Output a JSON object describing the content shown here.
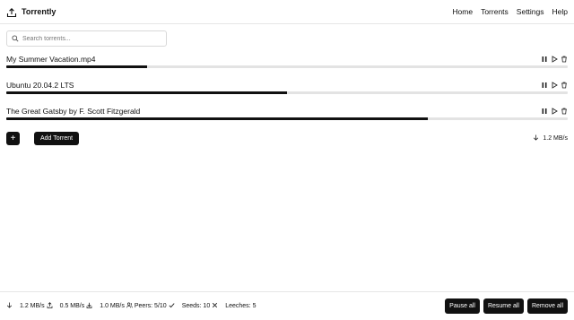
{
  "app": {
    "title": "Torrently"
  },
  "nav": {
    "items": [
      "Home",
      "Torrents",
      "Settings",
      "Help"
    ]
  },
  "search": {
    "placeholder": "Search torrents...",
    "value": ""
  },
  "torrents": [
    {
      "name": "My Summer Vacation.mp4",
      "progress": 0.25
    },
    {
      "name": "Ubuntu 20.04.2 LTS",
      "progress": 0.5
    },
    {
      "name": "The Great Gatsby by F. Scott Fitzgerald",
      "progress": 0.75
    }
  ],
  "toolbar": {
    "plus_label": "+",
    "add_label": "Add Torrent",
    "download_speed": "1.2 MB/s"
  },
  "footer": {
    "download": "1.2 MB/s",
    "upload": "0.5 MB/s",
    "download2": "1.0 MB/s",
    "peers": "Peers: 5/10",
    "seeds": "Seeds: 10",
    "leeches": "Leeches: 5",
    "pause_all": "Pause all",
    "resume_all": "Resume all",
    "remove_all": "Remove all"
  },
  "colors": {
    "accent": "#111111",
    "track": "#e3e3e3",
    "border": "#e6e6e6"
  },
  "icons": {
    "brand": "upload-box-icon",
    "row_actions": [
      "pause-icon",
      "play-icon",
      "trash-icon"
    ],
    "footer": [
      "download-icon",
      "upload-icon",
      "download-icon",
      "users-icon",
      "check-icon",
      "x-icon"
    ]
  }
}
